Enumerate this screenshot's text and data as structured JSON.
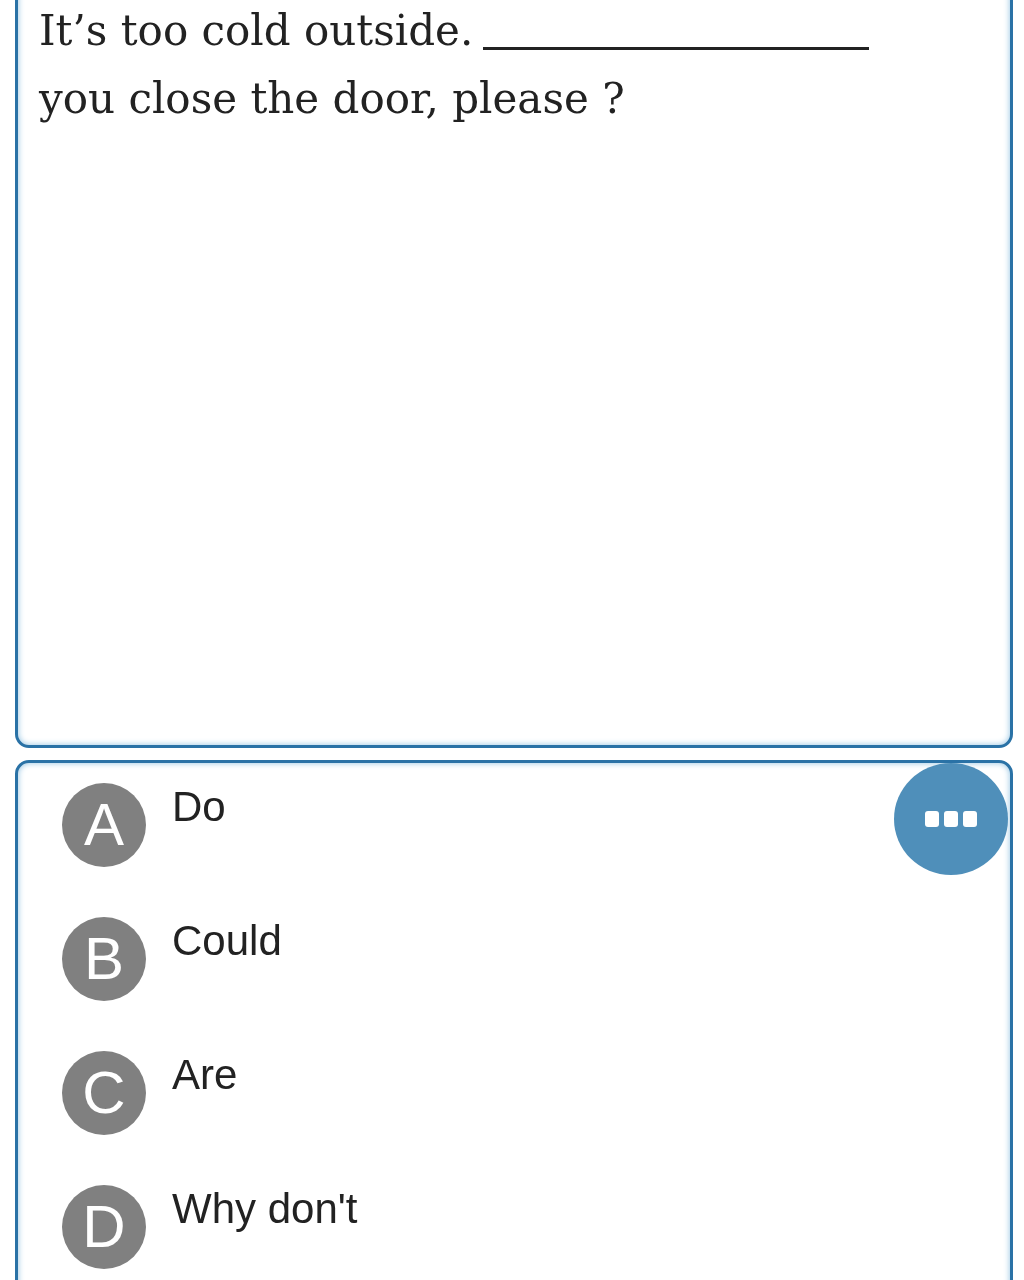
{
  "question": {
    "text_before_blank": "It’s too cold outside.",
    "text_after_blank": "you close the door, please ?"
  },
  "options": [
    {
      "letter": "A",
      "text": "Do"
    },
    {
      "letter": "B",
      "text": "Could"
    },
    {
      "letter": "C",
      "text": "Are"
    },
    {
      "letter": "D",
      "text": "Why don't"
    }
  ]
}
